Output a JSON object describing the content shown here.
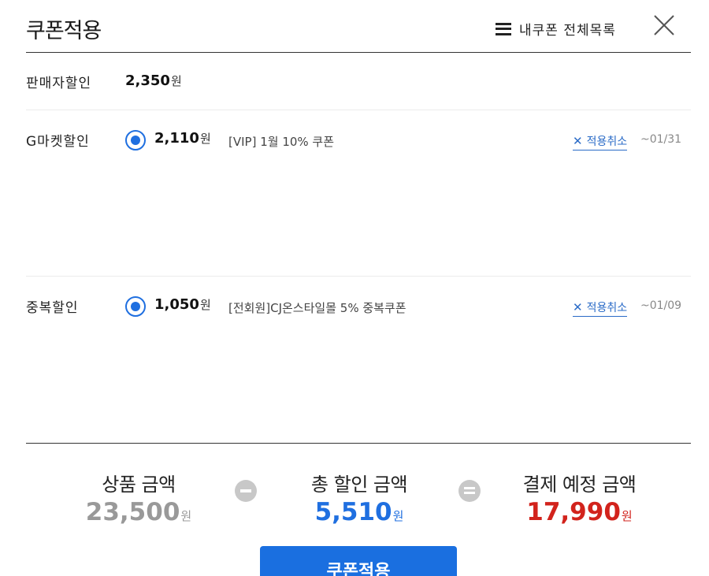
{
  "header": {
    "title": "쿠폰적용",
    "my_coupons_label": "내쿠폰 전체목록",
    "menu_icon": "hamburger-icon",
    "close_icon": "close-icon"
  },
  "seller_discount": {
    "label": "판매자할인",
    "amount": "2,350",
    "unit": "원"
  },
  "gmarket_discount": {
    "label": "G마켓할인",
    "amount": "2,110",
    "unit": "원",
    "coupon_name": "[VIP] 1월 10% 쿠폰",
    "cancel_label": "적용취소",
    "expire": "~01/31",
    "selected": true
  },
  "duplicate_discount": {
    "label": "중복할인",
    "amount": "1,050",
    "unit": "원",
    "coupon_name": "[전회원]CJ온스타일몰 5% 중복쿠폰",
    "cancel_label": "적용취소",
    "expire": "~01/09",
    "selected": true
  },
  "summary": {
    "product_label": "상품 금액",
    "product_amount": "23,500",
    "total_discount_label": "총 할인 금액",
    "total_discount_amount": "5,510",
    "payment_label": "결제 예정 금액",
    "payment_amount": "17,990",
    "unit": "원"
  },
  "apply_button": "쿠폰적용",
  "colors": {
    "accent": "#1f6fe0",
    "payment_red": "#d2231c",
    "muted_gray": "#999999"
  }
}
